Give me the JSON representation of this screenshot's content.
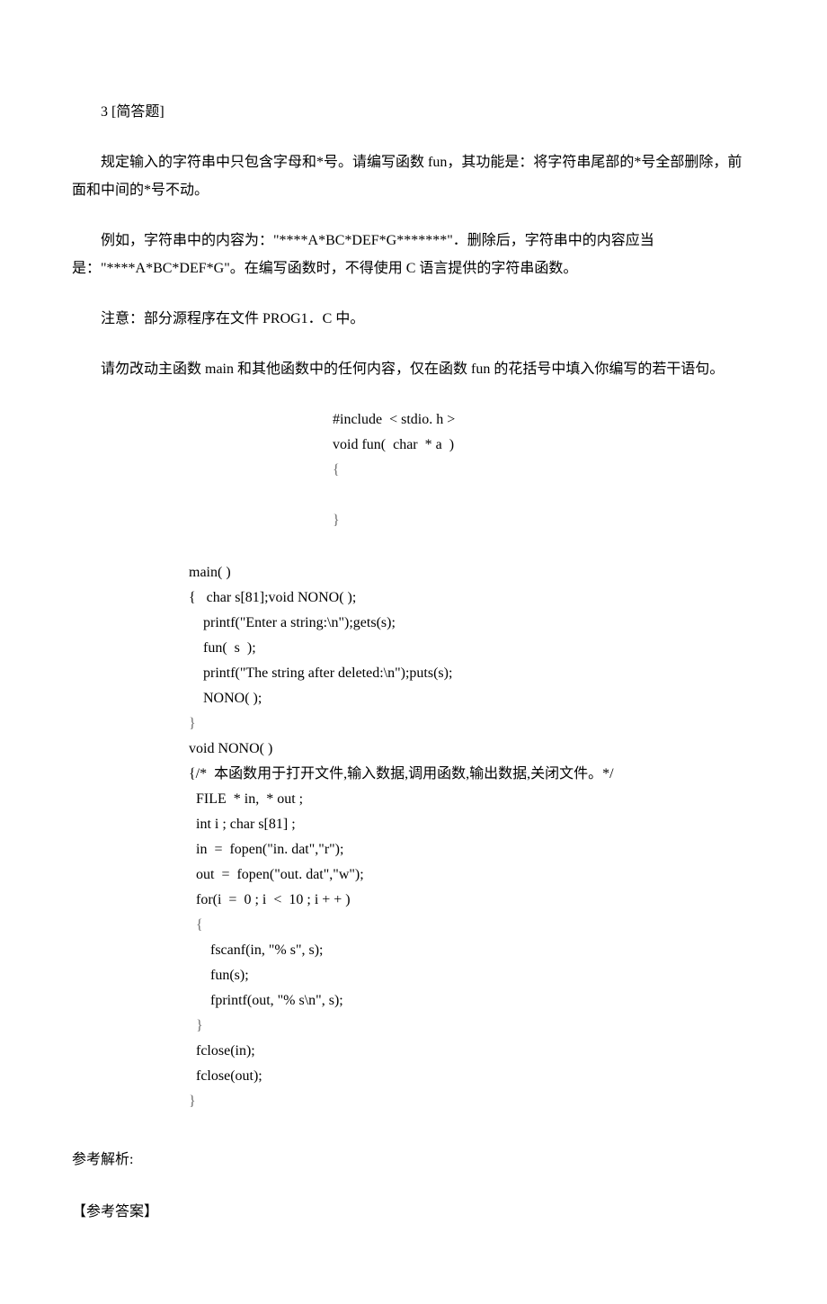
{
  "question": {
    "number_label": "3 [简答题]",
    "p1": "规定输入的字符串中只包含字母和*号。请编写函数 fun，其功能是：将字符串尾部的*号全部删除，前面和中间的*号不动。",
    "p2": "例如，字符串中的内容为：\"****A*BC*DEF*G*******\"．删除后，字符串中的内容应当是：\"****A*BC*DEF*G\"。在编写函数时，不得使用 C 语言提供的字符串函数。",
    "p3": "注意：部分源程序在文件 PROG1．C 中。",
    "p4": "请勿改动主函数 main 和其他函数中的任何内容，仅在函数 fun 的花括号中填入你编写的若干语句。"
  },
  "code_top": {
    "l1": "#include  < stdio. h >",
    "l2": "void fun(  char  * a  )",
    "l3": "{",
    "l4": "",
    "l5": "}"
  },
  "code_main": {
    "l1": "main( )",
    "l2": "{   char s[81];void NONO( );",
    "l3": "    printf(\"Enter a string:\\n\");gets(s);",
    "l4": "    fun(  s  );",
    "l5": "    printf(\"The string after deleted:\\n\");puts(s);",
    "l6": "    NONO( );",
    "l7": "}",
    "l8": "void NONO( )",
    "l9": "{/*  本函数用于打开文件,输入数据,调用函数,输出数据,关闭文件。*/",
    "l10": "  FILE  * in,  * out ;",
    "l11": "  int i ; char s[81] ;",
    "l12": "  in  =  fopen(\"in. dat\",\"r\");",
    "l13": "  out  =  fopen(\"out. dat\",\"w\");",
    "l14": "  for(i  =  0 ; i  <  10 ; i + + )",
    "l15": "  {",
    "l16": "      fscanf(in, \"% s\", s);",
    "l17": "      fun(s);",
    "l18": "      fprintf(out, \"% s\\n\", s);",
    "l19": "  }",
    "l20": "  fclose(in);",
    "l21": "  fclose(out);",
    "l22": "}"
  },
  "answer": {
    "analysis_label": "参考解析:",
    "reference_label": "【参考答案】"
  }
}
